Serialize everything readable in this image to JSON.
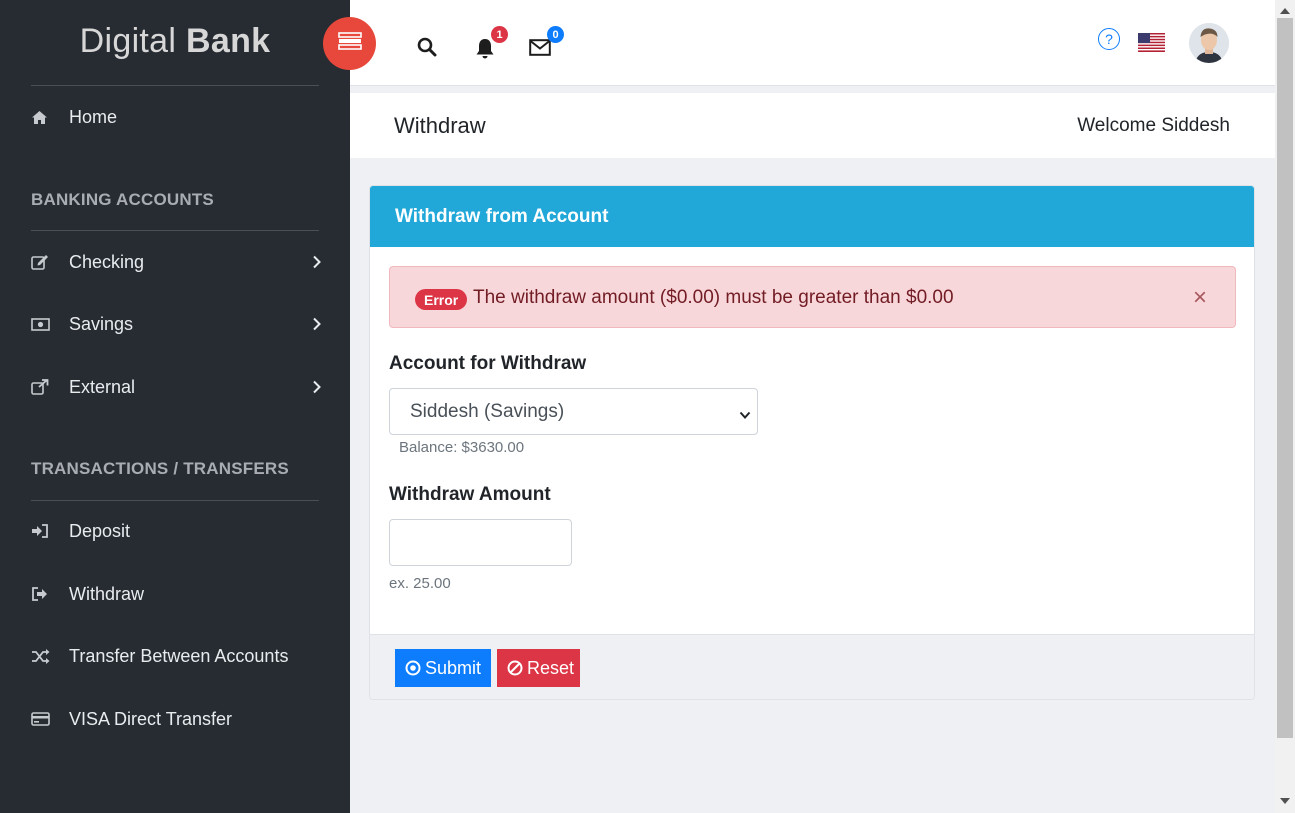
{
  "brand": {
    "light": "Digital",
    "bold": "Bank"
  },
  "sidebar": {
    "home": "Home",
    "banking_title": "BANKING ACCOUNTS",
    "banking_items": [
      "Checking",
      "Savings",
      "External"
    ],
    "transactions_title": "TRANSACTIONS / TRANSFERS",
    "transaction_items": [
      "Deposit",
      "Withdraw",
      "Transfer Between Accounts",
      "VISA Direct Transfer"
    ]
  },
  "header": {
    "notifications_count": "1",
    "messages_count": "0",
    "help_glyph": "?",
    "icons": [
      "menu-icon",
      "search-icon",
      "bell-icon",
      "envelope-icon",
      "help-icon",
      "us-flag-icon",
      "avatar"
    ]
  },
  "page": {
    "title": "Withdraw",
    "welcome": "Welcome Siddesh"
  },
  "form": {
    "card_title": "Withdraw from Account",
    "error_badge": "Error",
    "error_message": "The withdraw amount ($0.00) must be greater than $0.00",
    "close_glyph": "×",
    "account_label": "Account for Withdraw",
    "account_selected": "Siddesh (Savings)",
    "balance_hint": "Balance: $3630.00",
    "amount_label": "Withdraw Amount",
    "amount_value": "",
    "amount_hint": "ex. 25.00",
    "submit_label": "Submit",
    "reset_label": "Reset"
  },
  "colors": {
    "sidebar_bg": "#272c33",
    "menu_button": "#e8483b",
    "card_header": "#21a8d9",
    "error": "#dc3545",
    "primary": "#0d7dfd"
  }
}
